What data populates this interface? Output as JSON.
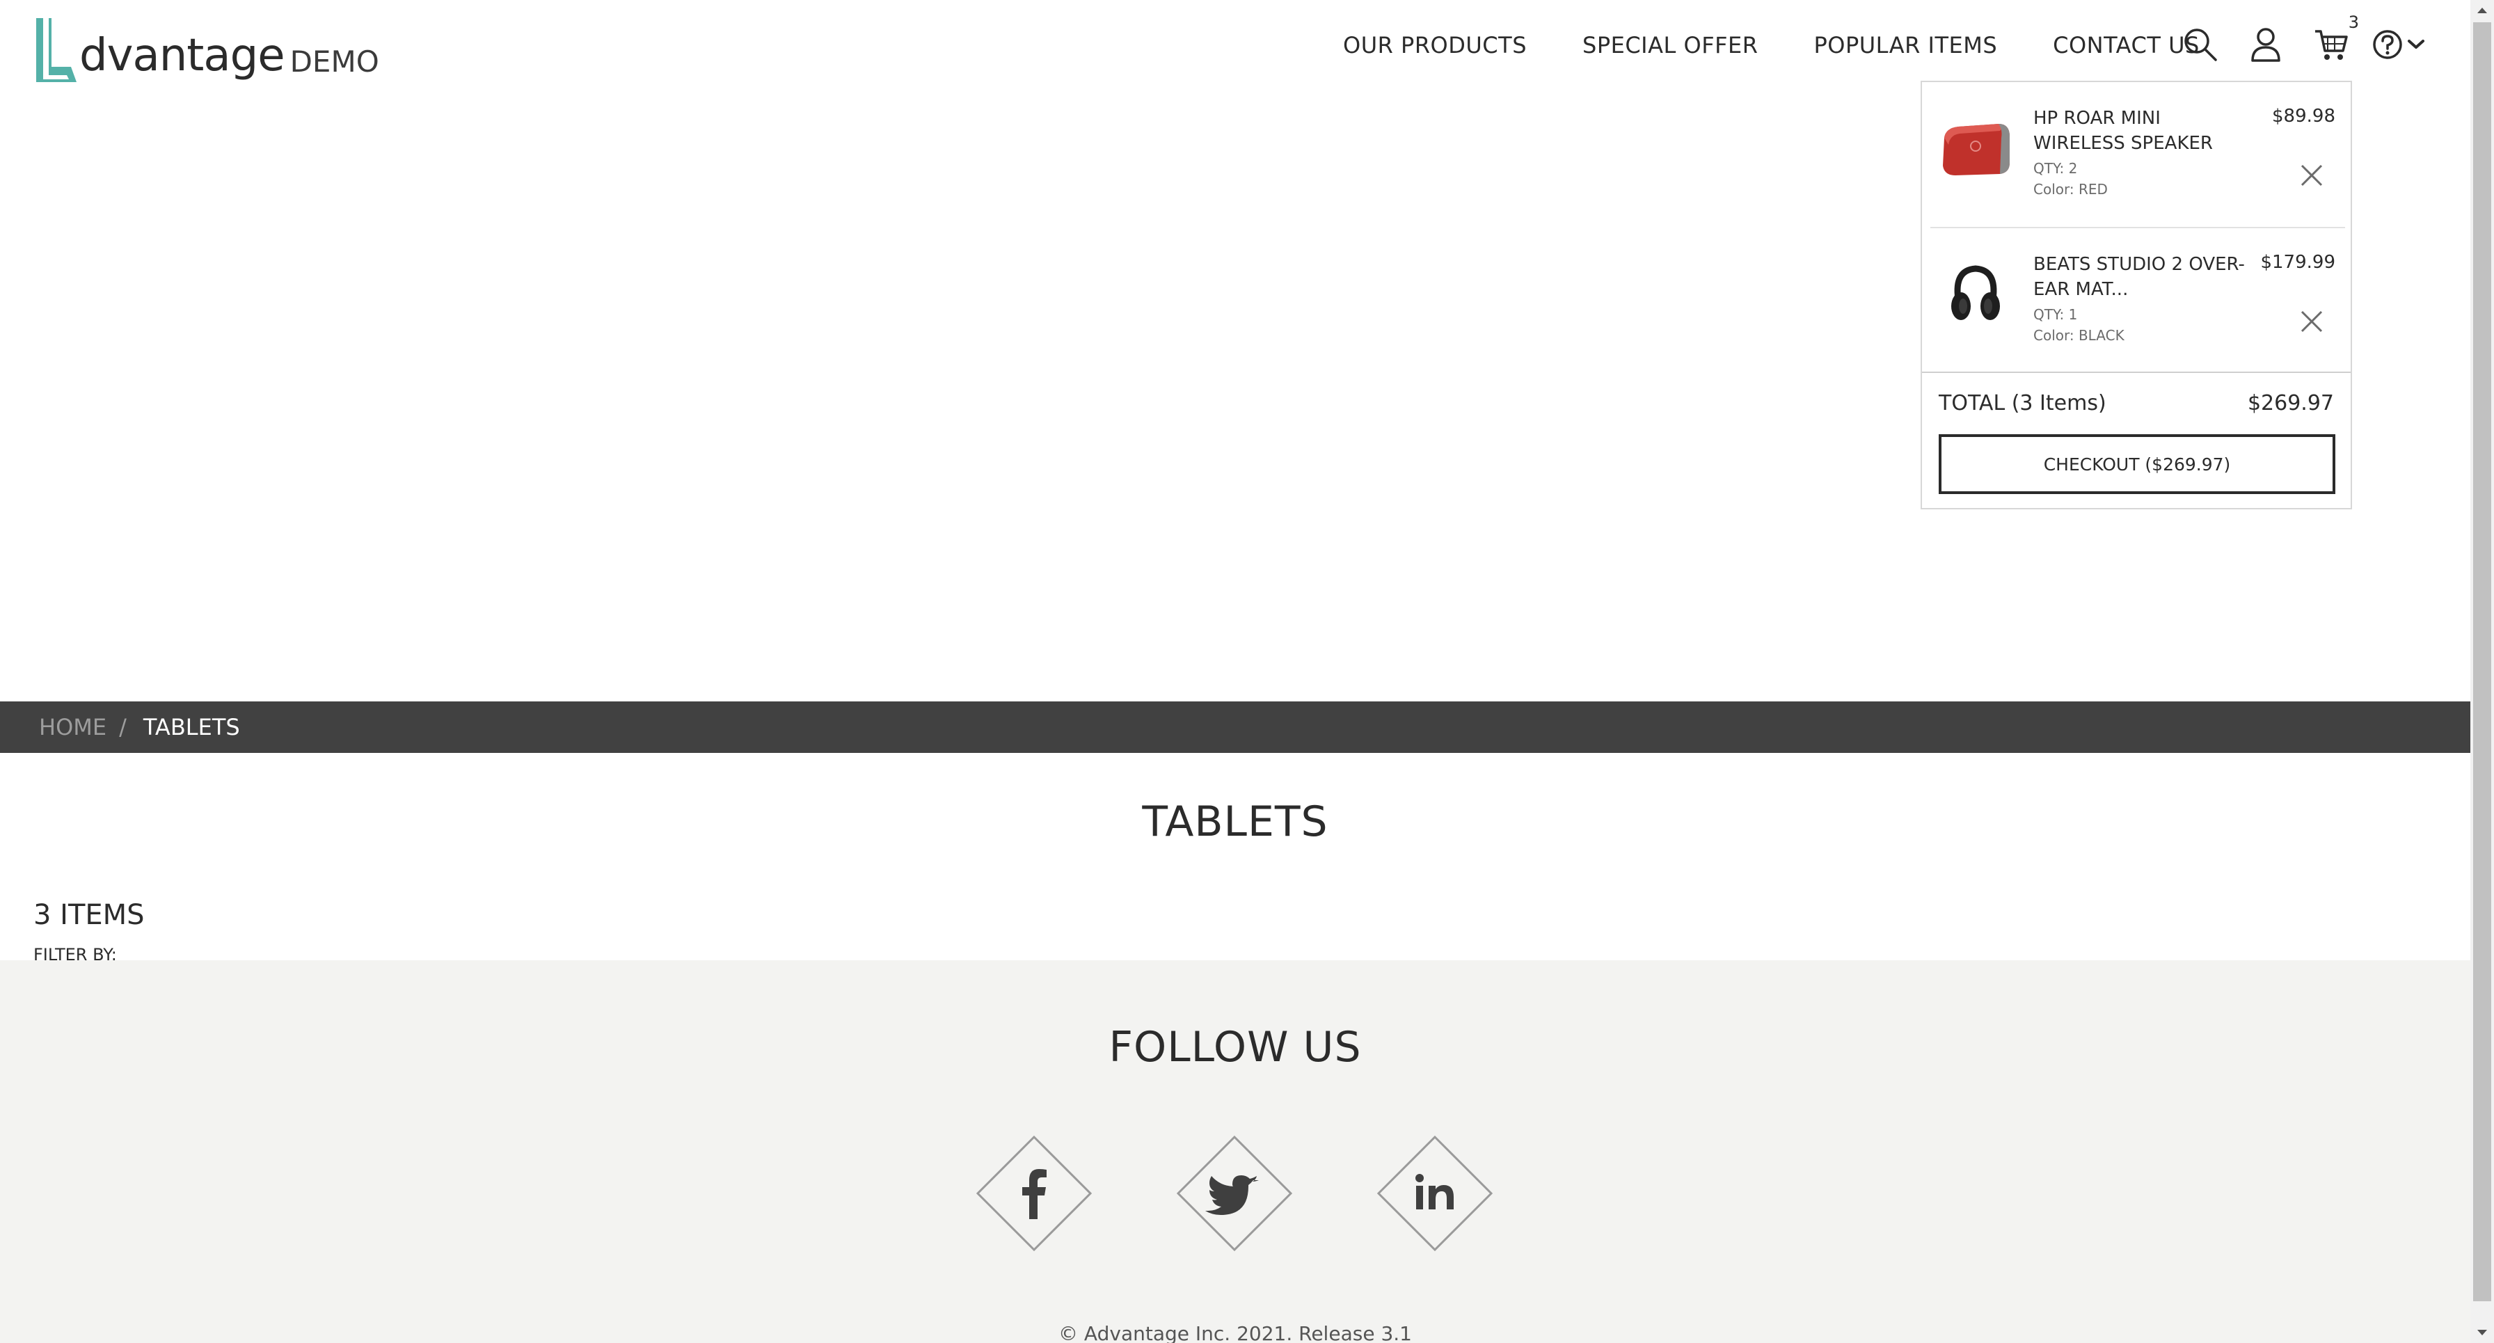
{
  "logo": {
    "word": "dvantage",
    "suffix": "DEMO",
    "brand_color": "#54b1a8"
  },
  "nav": {
    "items": [
      {
        "label": "OUR PRODUCTS"
      },
      {
        "label": "SPECIAL OFFER"
      },
      {
        "label": "POPULAR ITEMS"
      },
      {
        "label": "CONTACT US"
      }
    ],
    "icons": [
      "search-icon",
      "user-icon",
      "cart-icon",
      "help-icon",
      "chevron-down-icon"
    ],
    "cart_count": "3"
  },
  "cart": {
    "items": [
      {
        "name": "HP ROAR MINI WIRELESS SPEAKER",
        "price": "$89.98",
        "qty": "QTY: 2",
        "color": "Color: RED",
        "thumb_color": "#c0312b"
      },
      {
        "name": "BEATS STUDIO 2 OVER-EAR MAT...",
        "price": "$179.99",
        "qty": "QTY: 1",
        "color": "Color: BLACK",
        "thumb_color": "#1e1e1e"
      }
    ],
    "total_label": "TOTAL (3 Items)",
    "total_value": "$269.97",
    "checkout_label": "CHECKOUT ($269.97)"
  },
  "breadcrumb": {
    "home": "HOME",
    "separator": "/",
    "current": "TABLETS"
  },
  "category": {
    "title": "TABLETS",
    "items_count": "3 ITEMS",
    "filter_label": "FILTER BY:"
  },
  "footer": {
    "follow_title": "FOLLOW US",
    "social": [
      "facebook-icon",
      "twitter-icon",
      "linkedin-icon"
    ],
    "copyright": "© Advantage Inc. 2021. Release 3.1"
  }
}
